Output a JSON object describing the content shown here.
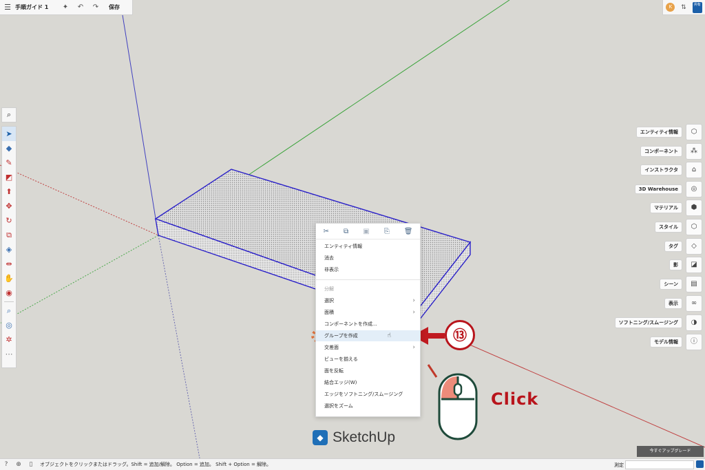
{
  "topbar": {
    "menu_icon": "☰",
    "title": "手順ガイド 1",
    "save_label": "保存"
  },
  "topright": {
    "avatar_letter": "K",
    "share_label": "共有"
  },
  "lefttools": [
    "search-icon",
    "select-icon",
    "eraser-icon",
    "pencil-icon",
    "rectangle-icon",
    "pushpull-icon",
    "move-icon",
    "rotate-icon",
    "scale-icon",
    "paint-icon",
    "section-icon",
    "orbit-icon",
    "tape-icon",
    "zoom-icon",
    "compass-icon",
    "walk-icon",
    "more-icon"
  ],
  "right_panels": [
    {
      "label": "エンティティ情報",
      "icon": "cube-icon"
    },
    {
      "label": "コンポーネント",
      "icon": "components-icon"
    },
    {
      "label": "インストラクタ",
      "icon": "grad-cap-icon"
    },
    {
      "label": "3D Warehouse",
      "icon": "warehouse-icon"
    },
    {
      "label": "マテリアル",
      "icon": "material-icon"
    },
    {
      "label": "スタイル",
      "icon": "style-icon"
    },
    {
      "label": "タグ",
      "icon": "tag-icon"
    },
    {
      "label": "影",
      "icon": "shadow-icon"
    },
    {
      "label": "シーン",
      "icon": "scene-icon"
    },
    {
      "label": "表示",
      "icon": "glasses-icon"
    },
    {
      "label": "ソフトニング/スムージング",
      "icon": "soften-icon"
    },
    {
      "label": "モデル情報",
      "icon": "info-icon"
    }
  ],
  "context_menu": {
    "items": [
      {
        "label": "エンティティ情報",
        "disabled": false,
        "submenu": false
      },
      {
        "label": "消去",
        "disabled": false,
        "submenu": false
      },
      {
        "label": "非表示",
        "disabled": false,
        "submenu": false
      },
      {
        "label": "分解",
        "disabled": true,
        "submenu": false
      },
      {
        "label": "選択",
        "disabled": false,
        "submenu": true
      },
      {
        "label": "面積",
        "disabled": false,
        "submenu": true
      },
      {
        "label": "コンポーネントを作成...",
        "disabled": false,
        "submenu": false
      },
      {
        "label": "グループを作成",
        "disabled": false,
        "submenu": false,
        "hover": true
      },
      {
        "label": "交差面",
        "disabled": false,
        "submenu": true
      },
      {
        "label": "ビューを揃える",
        "disabled": false,
        "submenu": false
      },
      {
        "label": "面を反転",
        "disabled": false,
        "submenu": false
      },
      {
        "label": "結合エッジ(W)",
        "disabled": false,
        "submenu": false
      },
      {
        "label": "エッジをソフトニング/スムージング",
        "disabled": false,
        "submenu": false
      },
      {
        "label": "選択をズーム",
        "disabled": false,
        "submenu": false
      }
    ]
  },
  "annotation": {
    "step_number": "⑬",
    "click_label": "Click"
  },
  "brand": {
    "name": "SketchUp"
  },
  "statusbar": {
    "message": "オブジェクトをクリックまたはドラッグ。Shift = 追加/解除。 Option = 追加。 Shift + Option = 解除。",
    "measure_label": "測定"
  },
  "upgrade_label": "今すぐアップグレード",
  "colors": {
    "accent_red": "#b8141b",
    "selection_blue": "#2a20c8",
    "brand_blue": "#1f6fb7"
  }
}
